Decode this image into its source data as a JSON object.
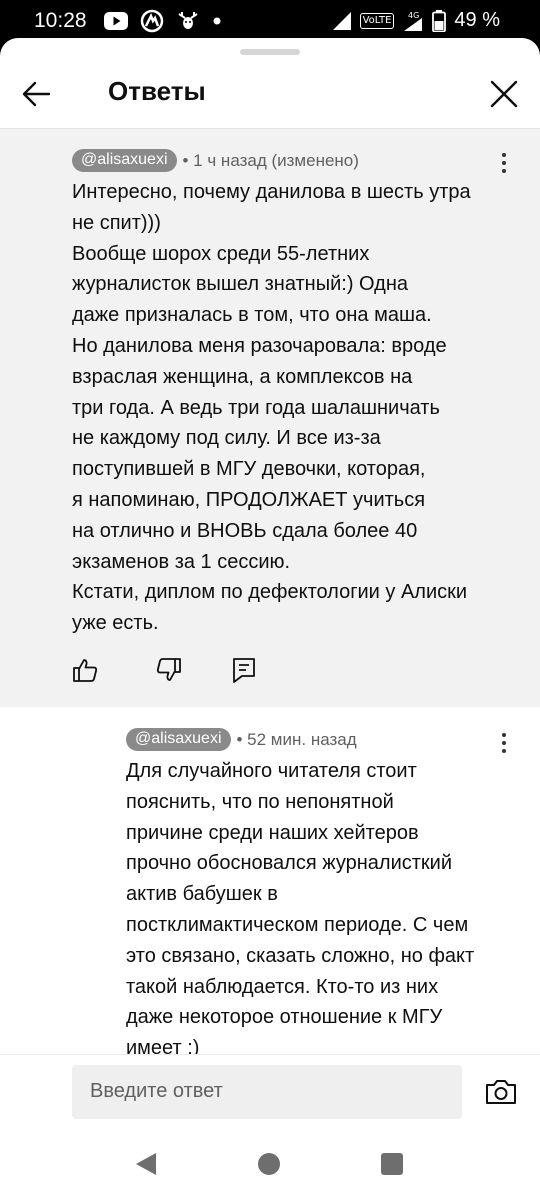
{
  "status_bar": {
    "time": "10:28",
    "network": "VoLTE",
    "signal_label": "4G",
    "battery": "49 %"
  },
  "header": {
    "title": "Ответы"
  },
  "parent_comment": {
    "author": "@alisaxuexi",
    "time": "• 1 ч назад (изменено)",
    "lines": [
      "Интересно, почему данилова в шесть утра",
      "не спит)))",
      "Вообще шорох среди 55-летних",
      "журналисток вышел знатный:) Одна",
      "даже призналась в том, что она маша.",
      "Но данилова меня разочаровала: вроде",
      "взраслая женщина, а комплексов на",
      "три года. А ведь три года шалашничать",
      "не каждому под силу. И все из-за",
      "поступившей в МГУ девочки, которая,",
      "я напоминаю, ПРОДОЛЖАЕТ учиться",
      "на отлично и ВНОВЬ сдала более 40",
      "экзаменов за 1 сессию.",
      "Кстати, диплом по дефектологии у Алиски",
      "уже есть."
    ]
  },
  "reply_comment": {
    "author": "@alisaxuexi",
    "time": "• 52 мин. назад",
    "lines": [
      "Для случайного читателя стоит",
      "пояснить, что по непонятной",
      "причине среди наших хейтеров",
      "прочно обосновался журналисткий",
      "актив бабушек в",
      "постклимактическом периоде. С чем",
      "это связано, сказать сложно, но факт",
      "такой наблюдается.  Кто-то из них",
      "даже некоторое отношение к МГУ",
      "имеет :)"
    ]
  },
  "reply_input": {
    "placeholder": "Введите ответ"
  },
  "colors": {
    "parent_background": "#f2f2f2",
    "author_chip": "#8a8a8a",
    "text": "#0f0f0f",
    "secondary_text": "#606060"
  }
}
